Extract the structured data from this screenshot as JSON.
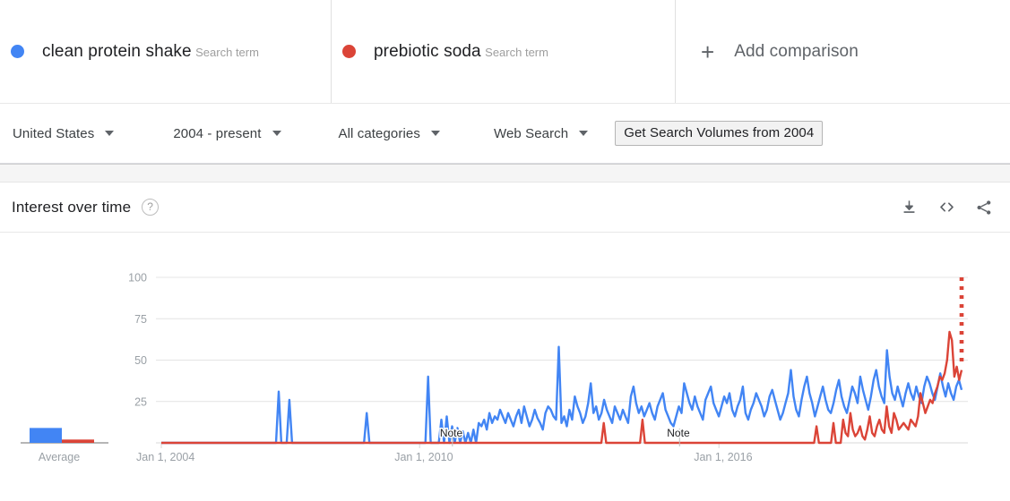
{
  "compare": {
    "terms": [
      {
        "name": "clean protein shake",
        "type": "Search term",
        "color": "#4285f4"
      },
      {
        "name": "prebiotic soda",
        "type": "Search term",
        "color": "#db4437"
      }
    ],
    "add_comparison_label": "Add comparison",
    "plus_glyph": "+"
  },
  "filters": {
    "region": "United States",
    "time_range": "2004 - present",
    "category": "All categories",
    "search_type": "Web Search",
    "volumes_button": "Get Search Volumes from 2004"
  },
  "panel": {
    "title": "Interest over time",
    "help_glyph": "?",
    "tools": [
      {
        "name": "download-icon"
      },
      {
        "name": "embed-code-icon"
      },
      {
        "name": "share-icon"
      }
    ]
  },
  "chart_data": {
    "type": "line",
    "title": "Interest over time",
    "xlabel": "",
    "ylabel": "",
    "ylim": [
      0,
      100
    ],
    "yticks": [
      25,
      50,
      75,
      100
    ],
    "xticks": [
      "Jan 1, 2004",
      "Jan 1, 2010",
      "Jan 1, 2016"
    ],
    "xtick_positions": [
      0.0,
      0.315,
      0.68
    ],
    "grid": true,
    "legend_position": "top",
    "average_panel": {
      "label": "Average",
      "values": [
        9,
        2
      ]
    },
    "annotations": [
      {
        "label": "Note",
        "x": 0.355
      },
      {
        "label": "Note",
        "x": 0.632
      }
    ],
    "series": [
      {
        "name": "clean protein shake",
        "color": "#4285f4",
        "values": [
          0,
          0,
          0,
          0,
          0,
          0,
          0,
          0,
          0,
          0,
          0,
          0,
          0,
          0,
          0,
          0,
          0,
          0,
          0,
          0,
          0,
          0,
          0,
          0,
          0,
          0,
          0,
          0,
          0,
          0,
          0,
          0,
          0,
          0,
          0,
          0,
          0,
          0,
          0,
          0,
          0,
          0,
          0,
          0,
          31,
          0,
          0,
          0,
          26,
          0,
          0,
          0,
          0,
          0,
          0,
          0,
          0,
          0,
          0,
          0,
          0,
          0,
          0,
          0,
          0,
          0,
          0,
          0,
          0,
          0,
          0,
          0,
          0,
          0,
          0,
          0,
          0,
          18,
          0,
          0,
          0,
          0,
          0,
          0,
          0,
          0,
          0,
          0,
          0,
          0,
          0,
          0,
          0,
          0,
          0,
          0,
          0,
          0,
          0,
          0,
          40,
          0,
          0,
          0,
          0,
          14,
          0,
          16,
          0,
          10,
          0,
          9,
          0,
          7,
          0,
          6,
          0,
          8,
          0,
          12,
          10,
          14,
          8,
          18,
          12,
          16,
          14,
          20,
          16,
          12,
          18,
          14,
          10,
          16,
          20,
          12,
          22,
          16,
          10,
          14,
          20,
          15,
          12,
          8,
          18,
          22,
          20,
          16,
          14,
          58,
          12,
          16,
          10,
          20,
          14,
          28,
          22,
          18,
          12,
          16,
          24,
          36,
          18,
          22,
          14,
          18,
          26,
          20,
          16,
          12,
          22,
          18,
          14,
          20,
          16,
          12,
          28,
          34,
          24,
          18,
          22,
          16,
          20,
          24,
          18,
          14,
          22,
          26,
          30,
          20,
          16,
          12,
          10,
          16,
          22,
          18,
          36,
          30,
          24,
          20,
          28,
          22,
          18,
          14,
          26,
          30,
          34,
          24,
          20,
          16,
          22,
          28,
          24,
          30,
          20,
          16,
          22,
          26,
          34,
          18,
          14,
          20,
          24,
          30,
          26,
          22,
          16,
          20,
          28,
          32,
          26,
          20,
          14,
          18,
          24,
          30,
          44,
          28,
          20,
          16,
          26,
          34,
          40,
          30,
          24,
          16,
          22,
          28,
          34,
          26,
          20,
          18,
          24,
          32,
          38,
          28,
          22,
          18,
          26,
          34,
          30,
          24,
          40,
          32,
          26,
          20,
          28,
          38,
          44,
          34,
          28,
          24,
          56,
          40,
          30,
          26,
          34,
          28,
          22,
          30,
          36,
          30,
          26,
          34,
          28,
          24,
          34,
          40,
          36,
          30,
          26,
          34,
          42,
          34,
          28,
          36,
          30,
          26,
          34,
          38,
          32
        ]
      },
      {
        "name": "prebiotic soda",
        "color": "#db4437",
        "values": [
          0,
          0,
          0,
          0,
          0,
          0,
          0,
          0,
          0,
          0,
          0,
          0,
          0,
          0,
          0,
          0,
          0,
          0,
          0,
          0,
          0,
          0,
          0,
          0,
          0,
          0,
          0,
          0,
          0,
          0,
          0,
          0,
          0,
          0,
          0,
          0,
          0,
          0,
          0,
          0,
          0,
          0,
          0,
          0,
          0,
          0,
          0,
          0,
          0,
          0,
          0,
          0,
          0,
          0,
          0,
          0,
          0,
          0,
          0,
          0,
          0,
          0,
          0,
          0,
          0,
          0,
          0,
          0,
          0,
          0,
          0,
          0,
          0,
          0,
          0,
          0,
          0,
          0,
          0,
          0,
          0,
          0,
          0,
          0,
          0,
          0,
          0,
          0,
          0,
          0,
          0,
          0,
          0,
          0,
          0,
          0,
          0,
          0,
          0,
          0,
          0,
          0,
          0,
          0,
          0,
          0,
          0,
          0,
          0,
          0,
          0,
          0,
          0,
          0,
          0,
          0,
          0,
          0,
          0,
          0,
          0,
          0,
          0,
          0,
          0,
          0,
          0,
          0,
          0,
          0,
          0,
          0,
          0,
          0,
          0,
          0,
          0,
          0,
          0,
          0,
          0,
          0,
          0,
          0,
          0,
          0,
          0,
          0,
          0,
          0,
          0,
          0,
          0,
          0,
          0,
          0,
          0,
          0,
          0,
          0,
          0,
          0,
          0,
          0,
          0,
          0,
          0,
          0,
          0,
          0,
          0,
          0,
          0,
          0,
          0,
          0,
          0,
          0,
          0,
          0,
          0,
          0,
          0,
          12,
          0,
          0,
          0,
          0,
          0,
          0,
          0,
          0,
          0,
          0,
          0,
          0,
          0,
          0,
          0,
          14,
          0,
          0,
          0,
          0,
          0,
          0,
          0,
          0,
          0,
          0,
          0,
          0,
          0,
          0,
          0,
          0,
          0,
          0,
          0,
          0,
          0,
          0,
          0,
          0,
          0,
          0,
          0,
          0,
          0,
          0,
          0,
          0,
          0,
          0,
          0,
          0,
          0,
          0,
          0,
          0,
          0,
          0,
          0,
          0,
          0,
          0,
          0,
          0,
          0,
          0,
          0,
          0,
          0,
          0,
          0,
          0,
          0,
          0,
          0,
          0,
          0,
          0,
          0,
          0,
          0,
          0,
          0,
          0,
          0,
          0,
          0,
          10,
          0,
          0,
          0,
          0,
          0,
          0,
          12,
          0,
          0,
          0,
          14,
          6,
          4,
          18,
          8,
          4,
          6,
          10,
          4,
          2,
          8,
          16,
          6,
          4,
          10,
          14,
          8,
          6,
          22,
          10,
          6,
          18,
          14,
          8,
          10,
          12,
          10,
          8,
          14,
          12,
          10,
          16,
          30,
          24,
          18,
          22,
          26,
          24,
          30,
          34,
          40,
          38,
          42,
          50,
          67,
          62,
          40,
          46,
          38,
          44
        ],
        "dotted_tail": {
          "from": 100,
          "to": 48
        }
      }
    ]
  }
}
